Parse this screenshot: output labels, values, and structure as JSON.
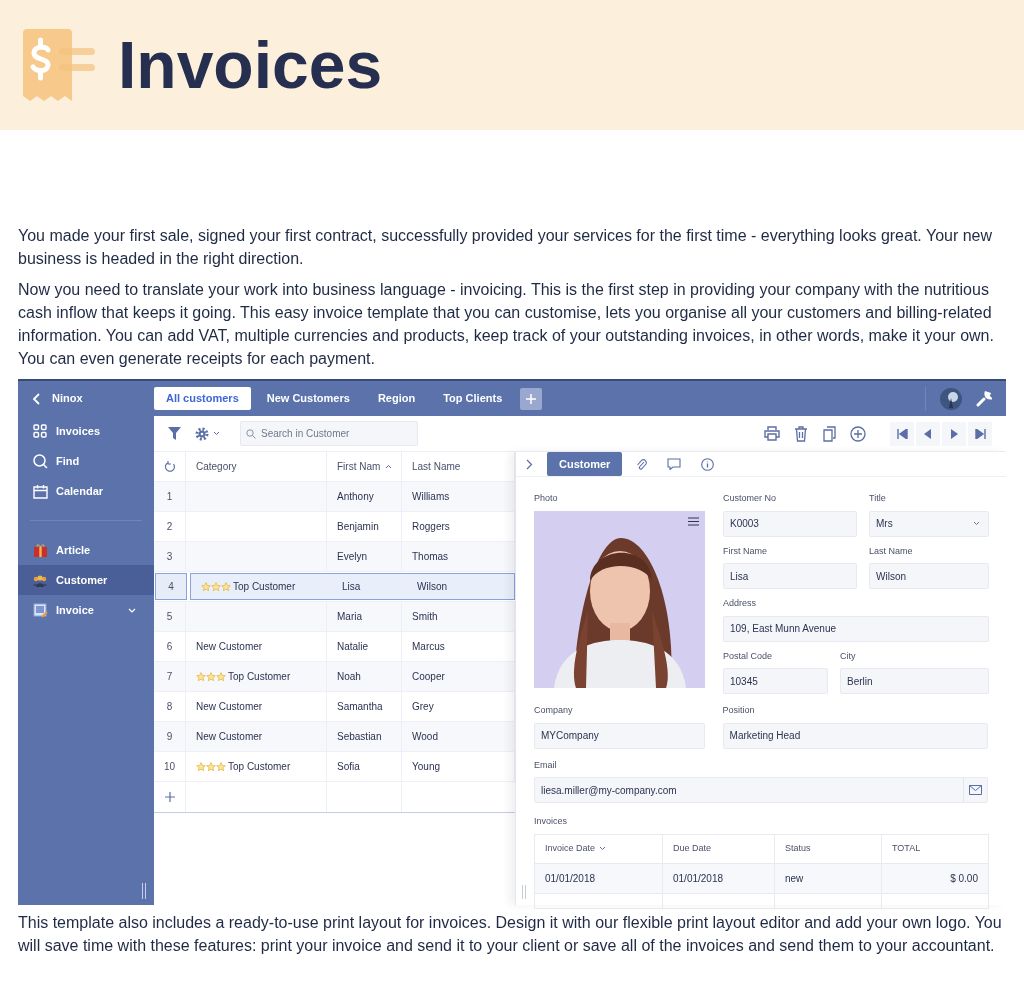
{
  "header": {
    "title": "Invoices"
  },
  "paragraphs": [
    "You made your first sale, signed your first contract, successfully provided your services for the first time - everything looks great. Your new business is headed in the right direction.",
    "Now you need to translate your work into business language - invoicing. This is the first step in providing your company with the nutritious cash inflow that keeps it going. This easy invoice template that you can customise, lets you organise all your customers and billing-related information. You can add VAT, multiple currencies and products, keep track of your outstanding invoices, in other words, make it your own. You can even generate receipts for each payment."
  ],
  "app": {
    "sidebar": {
      "back_label": "Ninox",
      "items": [
        {
          "label": "Invoices",
          "selected": false
        },
        {
          "label": "Find",
          "selected": false
        },
        {
          "label": "Calendar",
          "selected": false
        },
        {
          "label": "Article",
          "selected": false
        },
        {
          "label": "Customer",
          "selected": true
        },
        {
          "label": "Invoice",
          "selected": false,
          "expanded": false
        }
      ]
    },
    "tabs": [
      {
        "label": "All customers",
        "selected": true
      },
      {
        "label": "New Customers",
        "selected": false
      },
      {
        "label": "Region",
        "selected": false
      },
      {
        "label": "Top Clients",
        "selected": false
      }
    ],
    "search": {
      "placeholder": "Search in Customer"
    },
    "table": {
      "columns": [
        "Category",
        "First Nam",
        "Last Name"
      ],
      "rows": [
        {
          "number": "1",
          "category": "",
          "first": "Anthony",
          "last": "Williams",
          "selected": false
        },
        {
          "number": "2",
          "category": "",
          "first": "Benjamin",
          "last": "Roggers",
          "selected": false
        },
        {
          "number": "3",
          "category": "",
          "first": "Evelyn",
          "last": "Thomas",
          "selected": false
        },
        {
          "number": "4",
          "category": "Top Customer",
          "stars": 3,
          "first": "Lisa",
          "last": "Wilson",
          "selected": true
        },
        {
          "number": "5",
          "category": "",
          "first": "Maria",
          "last": "Smith",
          "selected": false
        },
        {
          "number": "6",
          "category": "New Customer",
          "first": "Natalie",
          "last": "Marcus",
          "selected": false
        },
        {
          "number": "7",
          "category": "Top Customer",
          "stars": 3,
          "first": "Noah",
          "last": "Cooper",
          "selected": false
        },
        {
          "number": "8",
          "category": "New Customer",
          "first": "Samantha",
          "last": "Grey",
          "selected": false
        },
        {
          "number": "9",
          "category": "New Customer",
          "first": "Sebastian",
          "last": "Wood",
          "selected": false
        },
        {
          "number": "10",
          "category": "Top Customer",
          "stars": 3,
          "first": "Sofia",
          "last": "Young",
          "selected": false
        }
      ]
    },
    "detail": {
      "tab": "Customer",
      "photo_label": "Photo",
      "fields": [
        {
          "label": "Customer No",
          "value": "K0003",
          "kind": "text"
        },
        {
          "label": "Title",
          "value": "Mrs",
          "kind": "select"
        },
        {
          "label": "First Name",
          "value": "Lisa",
          "kind": "text"
        },
        {
          "label": "Last Name",
          "value": "Wilson",
          "kind": "text"
        },
        {
          "label": "Address",
          "value": "109, East Munn Avenue",
          "kind": "text"
        },
        {
          "label": "Postal Code",
          "value": "10345",
          "kind": "text"
        },
        {
          "label": "City",
          "value": "Berlin",
          "kind": "text"
        },
        {
          "label": "Company",
          "value": "MYCompany",
          "kind": "text"
        },
        {
          "label": "Position",
          "value": "Marketing Head",
          "kind": "text"
        },
        {
          "label": "Email",
          "value": "liesa.miller@my-company.com",
          "kind": "email"
        }
      ],
      "invoices": {
        "label": "Invoices",
        "columns": [
          "Invoice Date",
          "Due Date",
          "Status",
          "TOTAL"
        ],
        "rows": [
          {
            "invoice_date": "01/01/2018",
            "due_date": "01/01/2018",
            "status": "new",
            "total": "$ 0.00"
          }
        ]
      }
    }
  },
  "footer_paragraph": "This template also includes a ready-to-use print layout for invoices. Design it with our flexible print layout editor and add your own logo. You will save time with these features: print your invoice and send it to your client or save all of the invoices and send them to your accountant."
}
